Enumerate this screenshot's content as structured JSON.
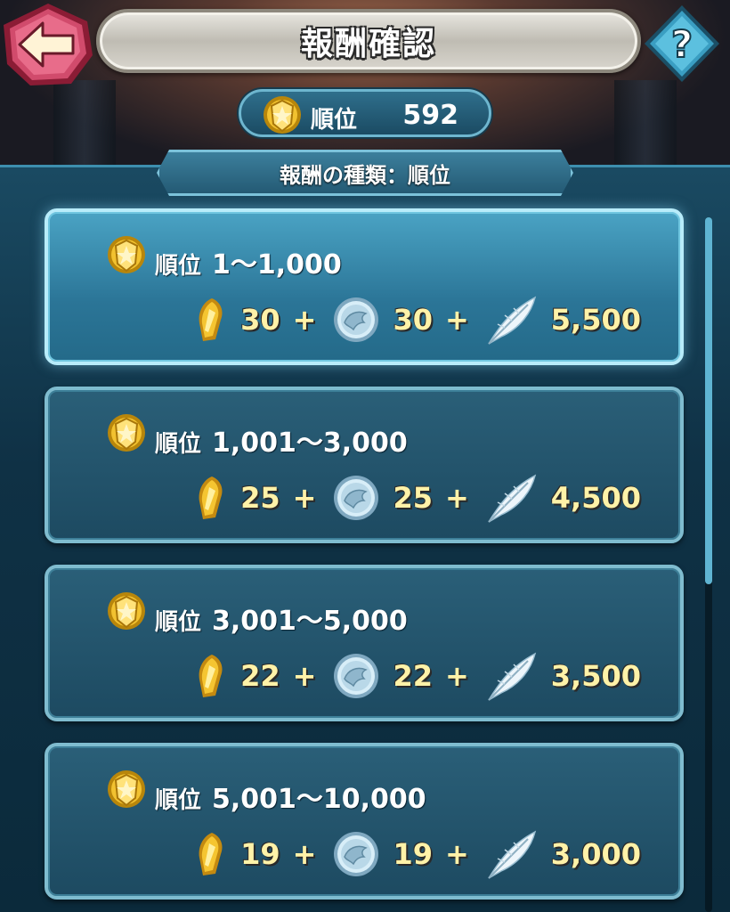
{
  "header": {
    "title": "報酬確認"
  },
  "rank": {
    "label": "順位",
    "value": "592"
  },
  "reward_type": "報酬の種類：順位",
  "tiers": [
    {
      "label": "順位",
      "range": "1～1,000",
      "orbs": "30",
      "feathers_badge": "30",
      "feathers": "5,500",
      "plus": "+"
    },
    {
      "label": "順位",
      "range": "1,001～3,000",
      "orbs": "25",
      "feathers_badge": "25",
      "feathers": "4,500",
      "plus": "+"
    },
    {
      "label": "順位",
      "range": "3,001～5,000",
      "orbs": "22",
      "feathers_badge": "22",
      "feathers": "3,500",
      "plus": "+"
    },
    {
      "label": "順位",
      "range": "5,001～10,000",
      "orbs": "19",
      "feathers_badge": "19",
      "feathers": "3,000",
      "plus": "+"
    }
  ],
  "icons": {
    "back": "arrow-left-icon",
    "help": "question-icon",
    "medal": "gold-medal-icon",
    "reward1": "gold-sword-icon",
    "reward2": "silver-dragon-coin-icon",
    "reward3": "feather-icon"
  },
  "colors": {
    "accent": "#7fbccf",
    "reward_text": "#fff2a8",
    "back_button": "#c2405e"
  }
}
